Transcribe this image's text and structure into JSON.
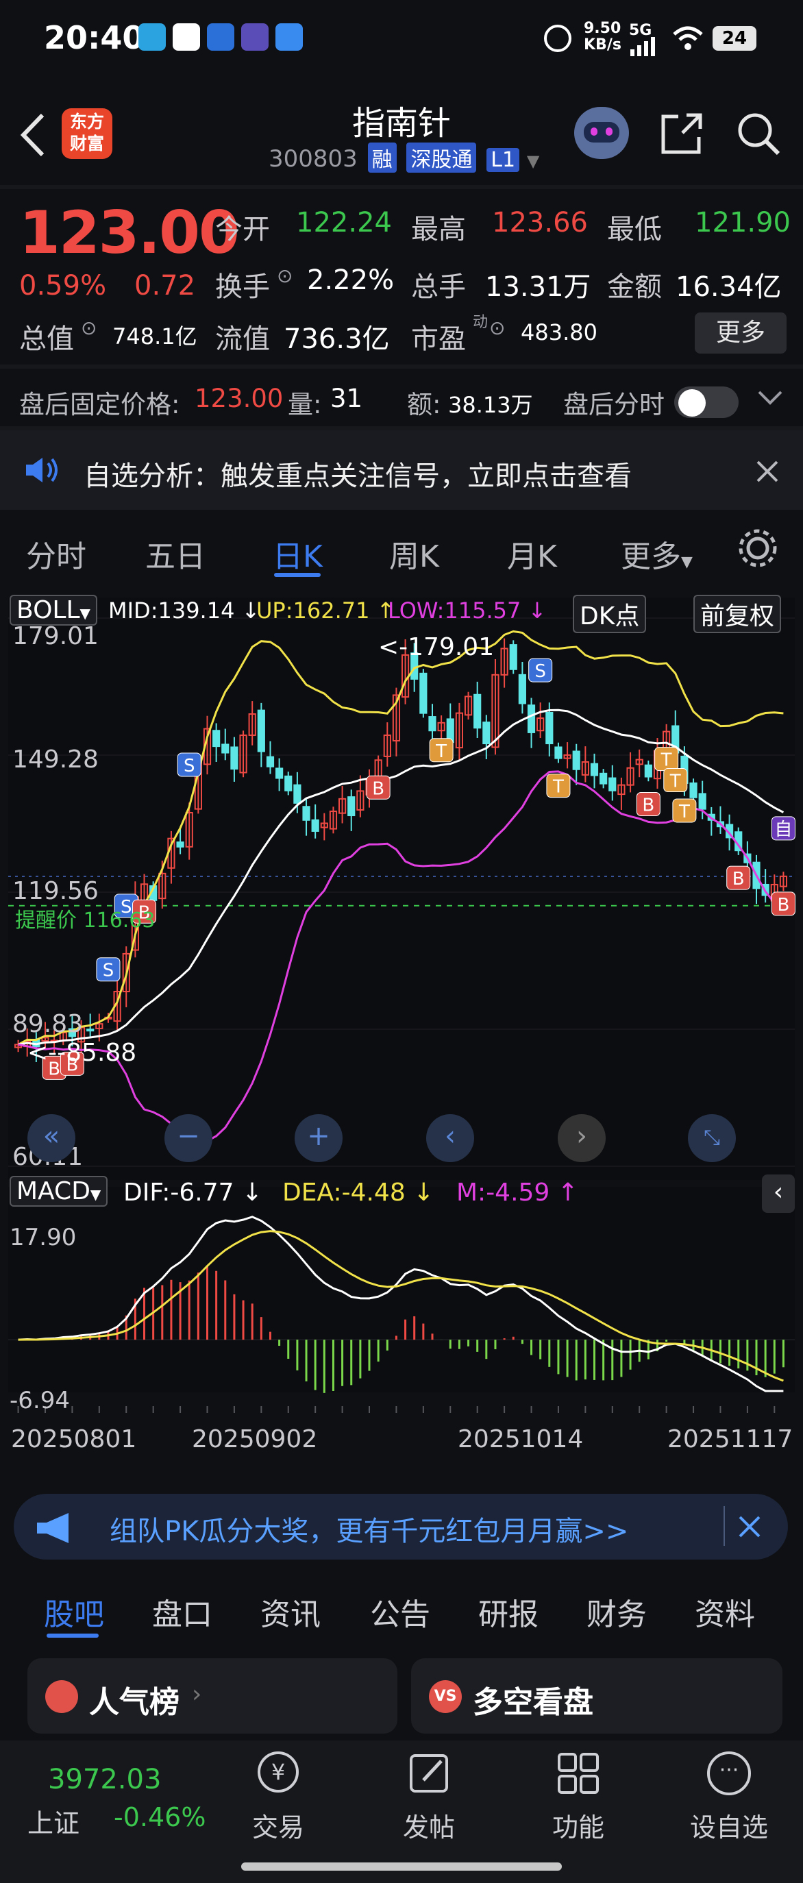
{
  "status_bar": {
    "time": "20:40",
    "net_speed": "9.50",
    "net_unit": "KB/s",
    "signal": "5G",
    "battery": "24"
  },
  "header": {
    "back_icon": "chevron-left-icon",
    "logo_text": "东方财富",
    "title": "指南针",
    "code": "300803",
    "tags": [
      "融",
      "深股通",
      "L1"
    ],
    "actions": [
      "robot-assistant-icon",
      "share-icon",
      "search-icon"
    ]
  },
  "quote": {
    "price": "123.00",
    "change_pct": "0.59%",
    "change": "0.72",
    "fields": [
      {
        "label": "今开",
        "value": "122.24",
        "color": "green"
      },
      {
        "label": "最高",
        "value": "123.66",
        "color": "red"
      },
      {
        "label": "最低",
        "value": "121.90",
        "color": "green"
      },
      {
        "label": "换手",
        "value": "2.22%",
        "color": "white"
      },
      {
        "label": "总手",
        "value": "13.31万",
        "color": "white"
      },
      {
        "label": "金额",
        "value": "16.34亿",
        "color": "white"
      },
      {
        "label": "总值",
        "value": "748.1亿",
        "color": "white"
      },
      {
        "label": "流值",
        "value": "736.3亿",
        "color": "white"
      },
      {
        "label": "市盈",
        "value": "483.80",
        "color": "white"
      }
    ],
    "pe_sup": "动",
    "more": "更多"
  },
  "after_hours": {
    "price_label": "盘后固定价格:",
    "price": "123.00",
    "vol_label": "量:",
    "vol": "31",
    "amt_label": "额:",
    "amt": "38.13万",
    "switch_label": "盘后分时"
  },
  "notice": {
    "text": "自选分析：触发重点关注信号，立即点击查看"
  },
  "tabs": [
    "分时",
    "五日",
    "日K",
    "周K",
    "月K",
    "更多"
  ],
  "active_tab": 2,
  "chart_data": [
    {
      "type": "candlestick",
      "indicator": "BOLL",
      "legend": {
        "mid_label": "MID:139.14",
        "up_label": "UP:162.71",
        "low_label": "LOW:115.57"
      },
      "buttons": [
        "DK点",
        "前复权"
      ],
      "y_ticks": [
        "179.01",
        "149.28",
        "119.56",
        "89.83",
        "60.11"
      ],
      "ylim": [
        60.11,
        179.01
      ],
      "max_label": "<-179.01",
      "min_label": "<--85.88",
      "alert_label": "提醒价 116.63",
      "alert_value": 116.63,
      "last_close": 123.0,
      "closes": [
        86.5,
        87.2,
        86.1,
        88.0,
        87.4,
        89.1,
        88.3,
        90.2,
        89.6,
        91.0,
        92.4,
        98.0,
        106.2,
        118.5,
        121.3,
        117.8,
        123.6,
        131.2,
        129.4,
        136.8,
        148.5,
        155.0,
        151.2,
        149.8,
        146.3,
        153.6,
        158.2,
        150.1,
        146.8,
        144.3,
        141.6,
        138.9,
        135.2,
        132.8,
        134.5,
        137.1,
        139.8,
        136.2,
        141.5,
        144.0,
        148.2,
        153.6,
        162.3,
        171.0,
        165.8,
        158.4,
        154.6,
        156.3,
        152.1,
        158.4,
        162.0,
        155.2,
        151.8,
        166.7,
        172.4,
        167.9,
        160.5,
        154.2,
        157.3,
        151.8,
        148.6,
        149.3,
        146.2,
        147.8,
        144.9,
        143.1,
        141.6,
        142.8,
        146.5,
        148.3,
        144.6,
        150.2,
        154.4,
        149.8,
        143.2,
        140.1,
        137.6,
        135.2,
        133.8,
        131.4,
        128.6,
        126.0,
        120.4,
        118.9,
        121.2,
        123.0
      ],
      "signals": [
        "S",
        "S",
        "S",
        "S",
        "B",
        "B",
        "B",
        "B",
        "B",
        "T",
        "T",
        "T",
        "T",
        "T",
        "B",
        "B",
        "自"
      ]
    },
    {
      "type": "bar",
      "indicator": "MACD",
      "legend": {
        "dif_label": "DIF:-6.77",
        "dea_label": "DEA:-4.48",
        "m_label": "M:-4.59"
      },
      "y_ticks": [
        "17.90",
        "-6.94"
      ],
      "ylim": [
        -6.94,
        17.9
      ],
      "x_ticks": [
        "20250801",
        "20250902",
        "20251014",
        "20251117"
      ]
    }
  ],
  "ad": {
    "text": "组队PK瓜分大奖，更有千元红包月月赢>>"
  },
  "bottom_tabs": [
    "股吧",
    "盘口",
    "资讯",
    "公告",
    "研报",
    "财务",
    "资料"
  ],
  "active_bottom_tab": 0,
  "cards": [
    {
      "title": "人气榜",
      "icon": "ranking-icon"
    },
    {
      "title": "多空看盘",
      "icon": "versus-icon"
    }
  ],
  "bottom_nav": {
    "index_value": "3972.03",
    "index_name": "上证",
    "index_change": "-0.46%",
    "items": [
      {
        "label": "交易",
        "icon": "yen-icon"
      },
      {
        "label": "发帖",
        "icon": "edit-icon"
      },
      {
        "label": "功能",
        "icon": "grid-icon"
      },
      {
        "label": "设自选",
        "icon": "more-icon"
      }
    ]
  },
  "colors": {
    "up": "#f04a44",
    "down": "#3cc84e",
    "accent": "#3d7cf0",
    "boll_up": "#f2e24a",
    "boll_low": "#e040e0",
    "boll_mid": "#ffffff",
    "dea": "#f2e24a",
    "m": "#e040e0"
  }
}
